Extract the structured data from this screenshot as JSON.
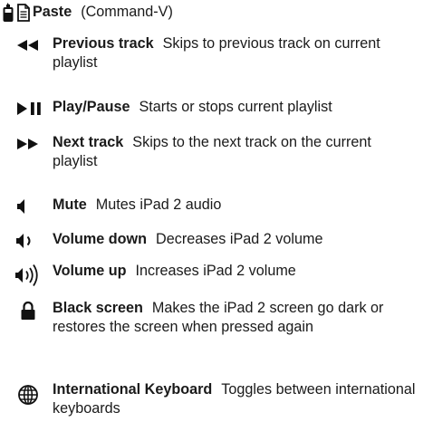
{
  "entries": [
    {
      "term": "Paste",
      "desc": "(Command-V)",
      "icon": "paste-icon"
    },
    {
      "term": "Previous track",
      "desc": "Skips to previous track on current playlist",
      "icon": "previous-track-icon"
    },
    {
      "term": "Play/Pause",
      "desc": "Starts or stops current playlist",
      "icon": "play-pause-icon"
    },
    {
      "term": "Next track",
      "desc": "Skips to the next track on the current playlist",
      "icon": "next-track-icon"
    },
    {
      "term": "Mute",
      "desc": "Mutes iPad 2 audio",
      "icon": "mute-icon"
    },
    {
      "term": "Volume down",
      "desc": "Decreases iPad 2 volume",
      "icon": "volume-down-icon"
    },
    {
      "term": "Volume up",
      "desc": "Increases iPad 2 volume",
      "icon": "volume-up-icon"
    },
    {
      "term": "Black screen",
      "desc": "Makes the iPad 2 screen go dark or restores the screen when pressed again",
      "icon": "lock-icon"
    },
    {
      "term": "International Keyboard",
      "desc": "Toggles between international keyboards",
      "icon": "globe-icon"
    }
  ]
}
